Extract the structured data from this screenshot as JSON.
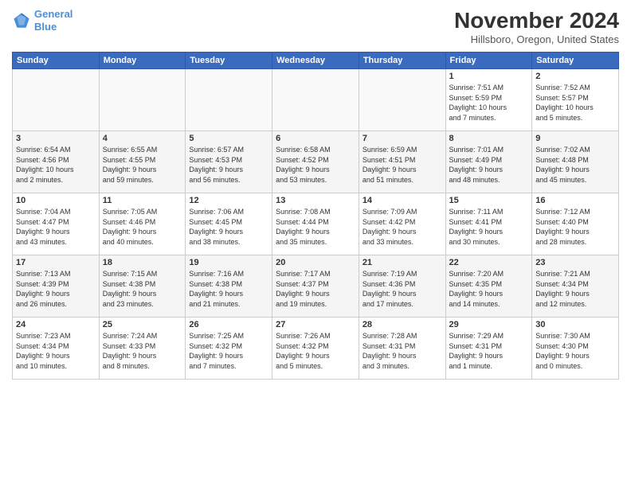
{
  "logo": {
    "line1": "General",
    "line2": "Blue"
  },
  "title": "November 2024",
  "location": "Hillsboro, Oregon, United States",
  "weekdays": [
    "Sunday",
    "Monday",
    "Tuesday",
    "Wednesday",
    "Thursday",
    "Friday",
    "Saturday"
  ],
  "weeks": [
    [
      {
        "day": "",
        "info": ""
      },
      {
        "day": "",
        "info": ""
      },
      {
        "day": "",
        "info": ""
      },
      {
        "day": "",
        "info": ""
      },
      {
        "day": "",
        "info": ""
      },
      {
        "day": "1",
        "info": "Sunrise: 7:51 AM\nSunset: 5:59 PM\nDaylight: 10 hours\nand 7 minutes."
      },
      {
        "day": "2",
        "info": "Sunrise: 7:52 AM\nSunset: 5:57 PM\nDaylight: 10 hours\nand 5 minutes."
      }
    ],
    [
      {
        "day": "3",
        "info": "Sunrise: 6:54 AM\nSunset: 4:56 PM\nDaylight: 10 hours\nand 2 minutes."
      },
      {
        "day": "4",
        "info": "Sunrise: 6:55 AM\nSunset: 4:55 PM\nDaylight: 9 hours\nand 59 minutes."
      },
      {
        "day": "5",
        "info": "Sunrise: 6:57 AM\nSunset: 4:53 PM\nDaylight: 9 hours\nand 56 minutes."
      },
      {
        "day": "6",
        "info": "Sunrise: 6:58 AM\nSunset: 4:52 PM\nDaylight: 9 hours\nand 53 minutes."
      },
      {
        "day": "7",
        "info": "Sunrise: 6:59 AM\nSunset: 4:51 PM\nDaylight: 9 hours\nand 51 minutes."
      },
      {
        "day": "8",
        "info": "Sunrise: 7:01 AM\nSunset: 4:49 PM\nDaylight: 9 hours\nand 48 minutes."
      },
      {
        "day": "9",
        "info": "Sunrise: 7:02 AM\nSunset: 4:48 PM\nDaylight: 9 hours\nand 45 minutes."
      }
    ],
    [
      {
        "day": "10",
        "info": "Sunrise: 7:04 AM\nSunset: 4:47 PM\nDaylight: 9 hours\nand 43 minutes."
      },
      {
        "day": "11",
        "info": "Sunrise: 7:05 AM\nSunset: 4:46 PM\nDaylight: 9 hours\nand 40 minutes."
      },
      {
        "day": "12",
        "info": "Sunrise: 7:06 AM\nSunset: 4:45 PM\nDaylight: 9 hours\nand 38 minutes."
      },
      {
        "day": "13",
        "info": "Sunrise: 7:08 AM\nSunset: 4:44 PM\nDaylight: 9 hours\nand 35 minutes."
      },
      {
        "day": "14",
        "info": "Sunrise: 7:09 AM\nSunset: 4:42 PM\nDaylight: 9 hours\nand 33 minutes."
      },
      {
        "day": "15",
        "info": "Sunrise: 7:11 AM\nSunset: 4:41 PM\nDaylight: 9 hours\nand 30 minutes."
      },
      {
        "day": "16",
        "info": "Sunrise: 7:12 AM\nSunset: 4:40 PM\nDaylight: 9 hours\nand 28 minutes."
      }
    ],
    [
      {
        "day": "17",
        "info": "Sunrise: 7:13 AM\nSunset: 4:39 PM\nDaylight: 9 hours\nand 26 minutes."
      },
      {
        "day": "18",
        "info": "Sunrise: 7:15 AM\nSunset: 4:38 PM\nDaylight: 9 hours\nand 23 minutes."
      },
      {
        "day": "19",
        "info": "Sunrise: 7:16 AM\nSunset: 4:38 PM\nDaylight: 9 hours\nand 21 minutes."
      },
      {
        "day": "20",
        "info": "Sunrise: 7:17 AM\nSunset: 4:37 PM\nDaylight: 9 hours\nand 19 minutes."
      },
      {
        "day": "21",
        "info": "Sunrise: 7:19 AM\nSunset: 4:36 PM\nDaylight: 9 hours\nand 17 minutes."
      },
      {
        "day": "22",
        "info": "Sunrise: 7:20 AM\nSunset: 4:35 PM\nDaylight: 9 hours\nand 14 minutes."
      },
      {
        "day": "23",
        "info": "Sunrise: 7:21 AM\nSunset: 4:34 PM\nDaylight: 9 hours\nand 12 minutes."
      }
    ],
    [
      {
        "day": "24",
        "info": "Sunrise: 7:23 AM\nSunset: 4:34 PM\nDaylight: 9 hours\nand 10 minutes."
      },
      {
        "day": "25",
        "info": "Sunrise: 7:24 AM\nSunset: 4:33 PM\nDaylight: 9 hours\nand 8 minutes."
      },
      {
        "day": "26",
        "info": "Sunrise: 7:25 AM\nSunset: 4:32 PM\nDaylight: 9 hours\nand 7 minutes."
      },
      {
        "day": "27",
        "info": "Sunrise: 7:26 AM\nSunset: 4:32 PM\nDaylight: 9 hours\nand 5 minutes."
      },
      {
        "day": "28",
        "info": "Sunrise: 7:28 AM\nSunset: 4:31 PM\nDaylight: 9 hours\nand 3 minutes."
      },
      {
        "day": "29",
        "info": "Sunrise: 7:29 AM\nSunset: 4:31 PM\nDaylight: 9 hours\nand 1 minute."
      },
      {
        "day": "30",
        "info": "Sunrise: 7:30 AM\nSunset: 4:30 PM\nDaylight: 9 hours\nand 0 minutes."
      }
    ]
  ]
}
